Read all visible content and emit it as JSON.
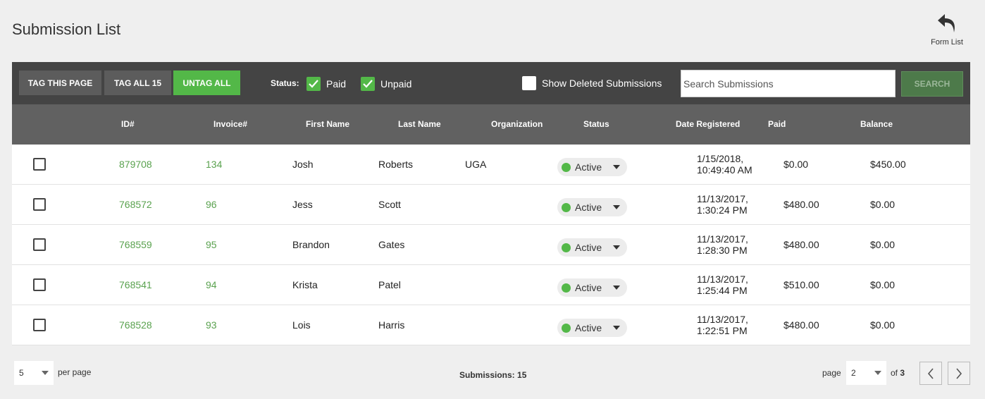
{
  "page": {
    "title": "Submission List",
    "form_list_label": "Form List"
  },
  "toolbar": {
    "tag_page": "TAG THIS PAGE",
    "tag_all": "TAG ALL 15",
    "untag_all": "UNTAG ALL",
    "status_label": "Status:",
    "paid_label": "Paid",
    "paid_checked": true,
    "unpaid_label": "Unpaid",
    "unpaid_checked": true,
    "show_deleted_label": "Show Deleted Submissions",
    "show_deleted_checked": false,
    "search_placeholder": "Search Submissions",
    "search_button": "SEARCH"
  },
  "table": {
    "headers": {
      "id": "ID#",
      "invoice": "Invoice#",
      "first": "First Name",
      "last": "Last Name",
      "org": "Organization",
      "status": "Status",
      "date": "Date Registered",
      "paid": "Paid",
      "balance": "Balance"
    },
    "rows": [
      {
        "id": "879708",
        "invoice": "134",
        "first": "Josh",
        "last": "Roberts",
        "org": "UGA",
        "status": "Active",
        "date": "1/15/2018, 10:49:40 AM",
        "paid": "$0.00",
        "balance": "$450.00"
      },
      {
        "id": "768572",
        "invoice": "96",
        "first": "Jess",
        "last": "Scott",
        "org": "",
        "status": "Active",
        "date": "11/13/2017, 1:30:24 PM",
        "paid": "$480.00",
        "balance": "$0.00"
      },
      {
        "id": "768559",
        "invoice": "95",
        "first": "Brandon",
        "last": "Gates",
        "org": "",
        "status": "Active",
        "date": "11/13/2017, 1:28:30 PM",
        "paid": "$480.00",
        "balance": "$0.00"
      },
      {
        "id": "768541",
        "invoice": "94",
        "first": "Krista",
        "last": "Patel",
        "org": "",
        "status": "Active",
        "date": "11/13/2017, 1:25:44 PM",
        "paid": "$510.00",
        "balance": "$0.00"
      },
      {
        "id": "768528",
        "invoice": "93",
        "first": "Lois",
        "last": "Harris",
        "org": "",
        "status": "Active",
        "date": "11/13/2017, 1:22:51 PM",
        "paid": "$480.00",
        "balance": "$0.00"
      }
    ]
  },
  "footer": {
    "per_page_value": "5",
    "per_page_label": "per page",
    "count_label": "Submissions: 15",
    "page_label": "page",
    "page_value": "2",
    "of_label": "of",
    "total_pages": "3"
  },
  "colors": {
    "accent_green": "#53b848",
    "link_green": "#5aa24f",
    "toolbar_bg": "#444444",
    "header_bg": "#616161"
  }
}
